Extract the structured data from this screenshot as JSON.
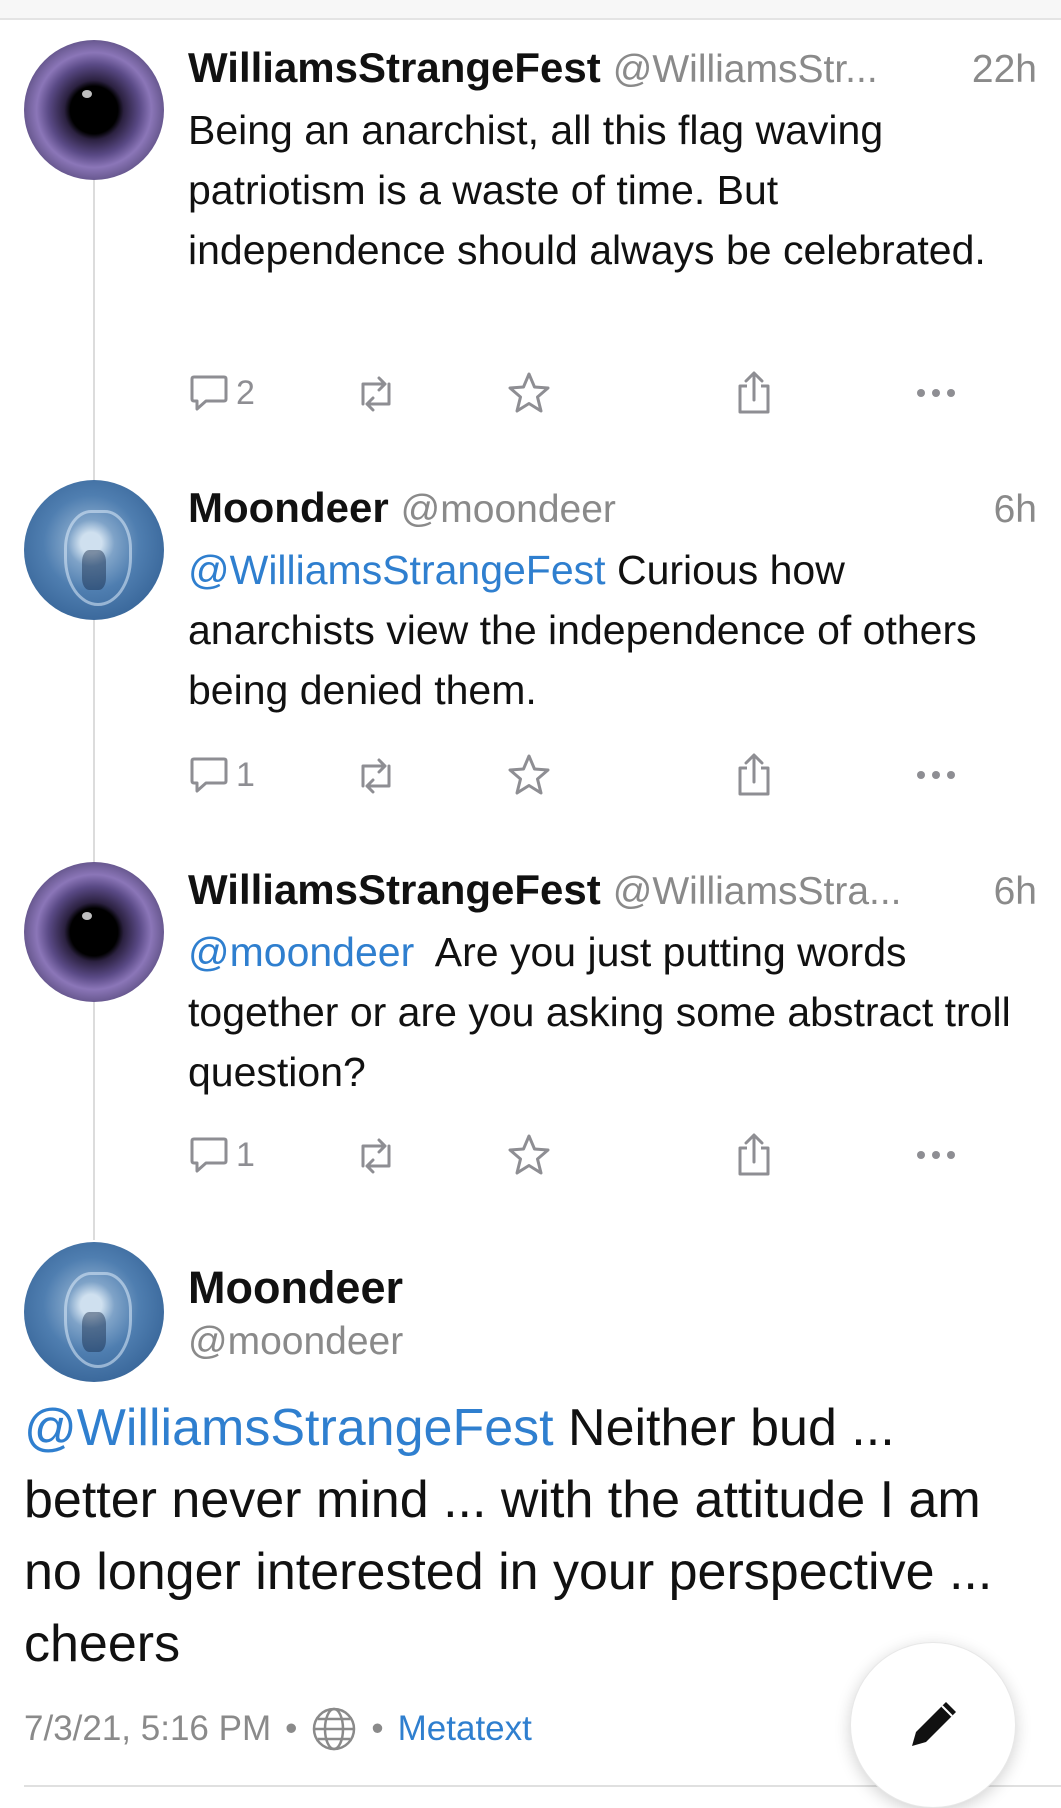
{
  "thread": [
    {
      "name": "WilliamsStrangeFest",
      "handle": "@WilliamsStr...",
      "time": "22h",
      "mention": "",
      "text": "Being an anarchist, all this flag waving patriotism is a waste of time. But independence should always be celebrated.",
      "replies": "2"
    },
    {
      "name": "Moondeer",
      "handle": "@moondeer",
      "time": "6h",
      "mention": "@WilliamsStrangeFest",
      "text": " Curious how anarchists view the independence of others being denied them.",
      "replies": "1"
    },
    {
      "name": "WilliamsStrangeFest",
      "handle": "@WilliamsStra...",
      "time": "6h",
      "mention": "@moondeer",
      "text": "  Are you just putting words together or are you asking some abstract troll question?",
      "replies": "1"
    }
  ],
  "main_post": {
    "name": "Moondeer",
    "handle": "@moondeer",
    "mention": "@WilliamsStrangeFest",
    "text": " Neither bud ... better never mind ... with the attitude I am no longer interested in your perspective ... cheers",
    "timestamp": "7/3/21, 5:16 PM",
    "separator": "•",
    "visibility_icon": "globe-icon",
    "client": "Metatext"
  },
  "icons": {
    "reply": "reply-icon",
    "boost": "boost-icon",
    "favorite": "star-icon",
    "share": "share-icon",
    "more": "more-icon",
    "compose": "pencil-icon"
  },
  "colors": {
    "accent": "#2f7fcf",
    "secondary_text": "#8a8a8a",
    "icon": "#8e8e93"
  }
}
